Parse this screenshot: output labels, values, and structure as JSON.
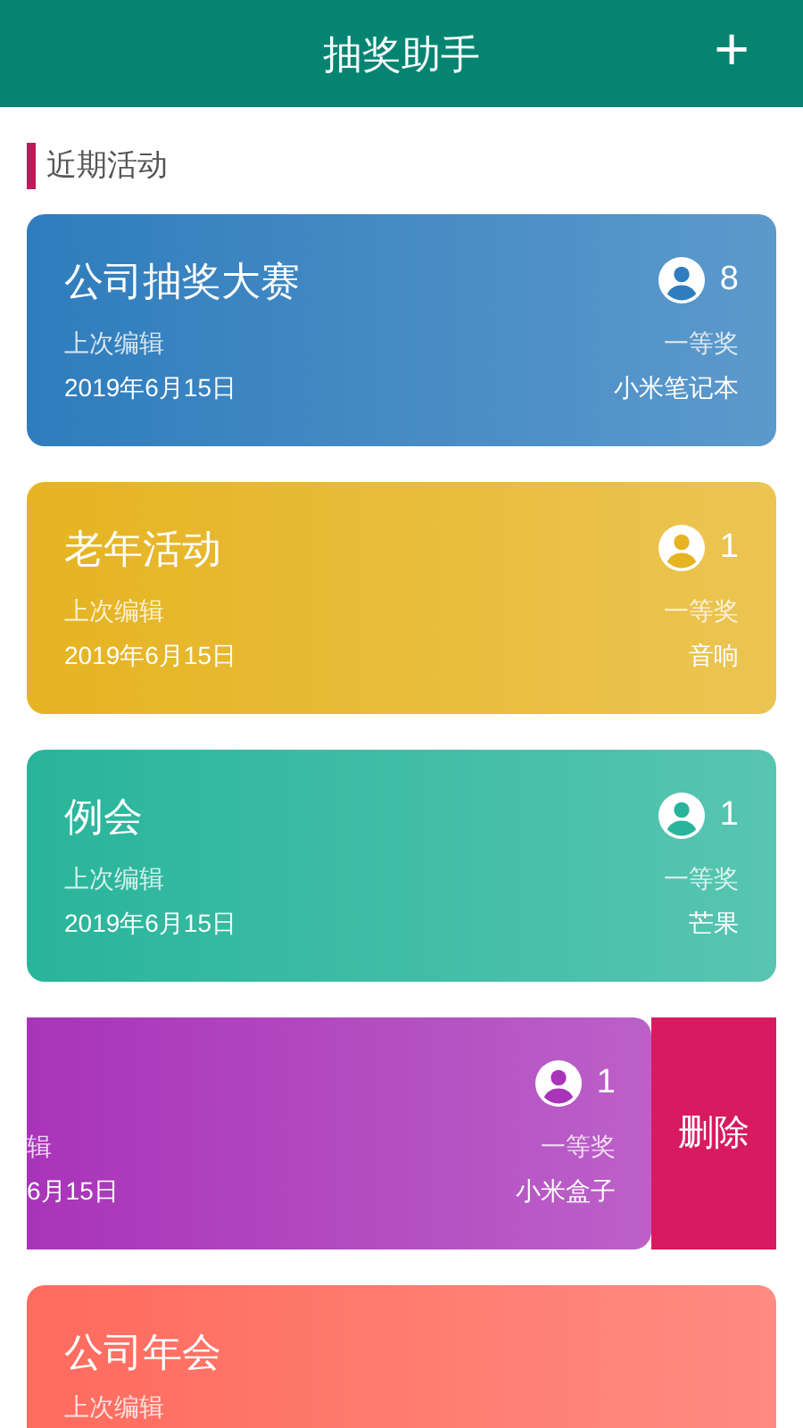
{
  "header": {
    "title": "抽奖助手",
    "add_button": "+"
  },
  "section": {
    "title": "近期活动"
  },
  "cards": [
    {
      "title": "公司抽奖大赛",
      "count": "8",
      "edit_label": "上次编辑",
      "date": "2019年6月15日",
      "prize_label": "一等奖",
      "prize": "小米笔记本",
      "color": "#2f7dbd",
      "swiped": false
    },
    {
      "title": "老年活动",
      "count": "1",
      "edit_label": "上次编辑",
      "date": "2019年6月15日",
      "prize_label": "一等奖",
      "prize": "音响",
      "color": "#e6b422",
      "swiped": false
    },
    {
      "title": "例会",
      "count": "1",
      "edit_label": "上次编辑",
      "date": "2019年6月15日",
      "prize_label": "一等奖",
      "prize": "芒果",
      "color": "#29b59b",
      "swiped": false
    },
    {
      "count": "1",
      "edit_label": "辑",
      "date": "6月15日",
      "prize_label": "一等奖",
      "prize": "小米盒子",
      "color": "#a934b9",
      "swiped": true,
      "delete_label": "删除"
    },
    {
      "title": "公司年会",
      "edit_label": "上次编辑",
      "color": "#ff6b5e",
      "swiped": false
    }
  ]
}
